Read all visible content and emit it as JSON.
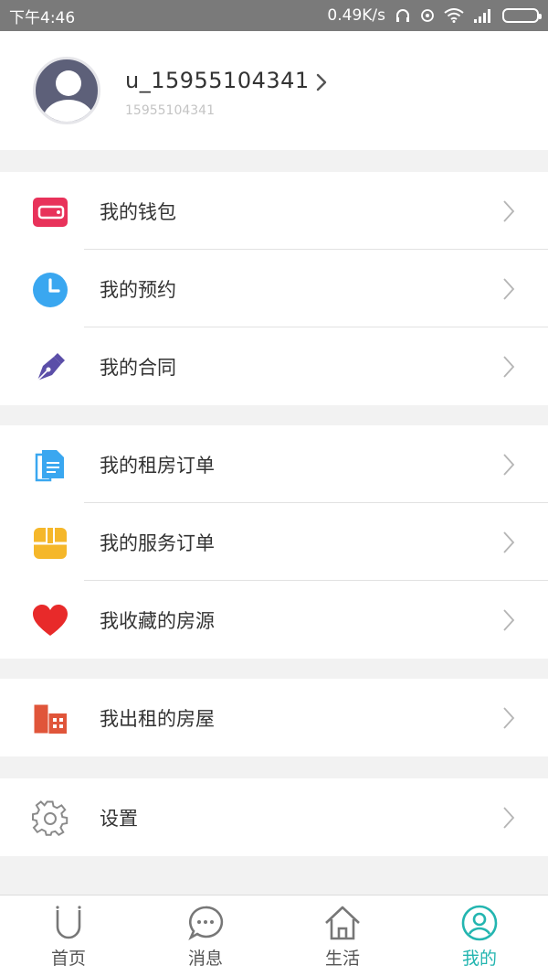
{
  "status_bar": {
    "time": "下午4:46",
    "speed": "0.49K/s"
  },
  "profile": {
    "username": "u_15955104341",
    "user_id": "15955104341"
  },
  "menu_groups": [
    {
      "items": [
        {
          "label": "我的钱包",
          "icon": "wallet-icon",
          "color": "#e8325a"
        },
        {
          "label": "我的预约",
          "icon": "clock-icon",
          "color": "#3aa7f0"
        },
        {
          "label": "我的合同",
          "icon": "pen-icon",
          "color": "#5b4ea8"
        }
      ]
    },
    {
      "items": [
        {
          "label": "我的租房订单",
          "icon": "document-icon",
          "color": "#3aa7f0"
        },
        {
          "label": "我的服务订单",
          "icon": "box-icon",
          "color": "#f5b72a"
        },
        {
          "label": "我收藏的房源",
          "icon": "heart-icon",
          "color": "#e82a2a"
        }
      ]
    },
    {
      "items": [
        {
          "label": "我出租的房屋",
          "icon": "building-icon",
          "color": "#e0553a"
        }
      ]
    },
    {
      "items": [
        {
          "label": "设置",
          "icon": "gear-icon",
          "color": "#8a8a8a"
        }
      ]
    }
  ],
  "tab_bar": {
    "tabs": [
      {
        "label": "首页",
        "icon": "home-u-icon",
        "active": false
      },
      {
        "label": "消息",
        "icon": "message-icon",
        "active": false
      },
      {
        "label": "生活",
        "icon": "house-icon",
        "active": false
      },
      {
        "label": "我的",
        "icon": "profile-icon",
        "active": true
      }
    ],
    "active_color": "#23b5b0"
  }
}
